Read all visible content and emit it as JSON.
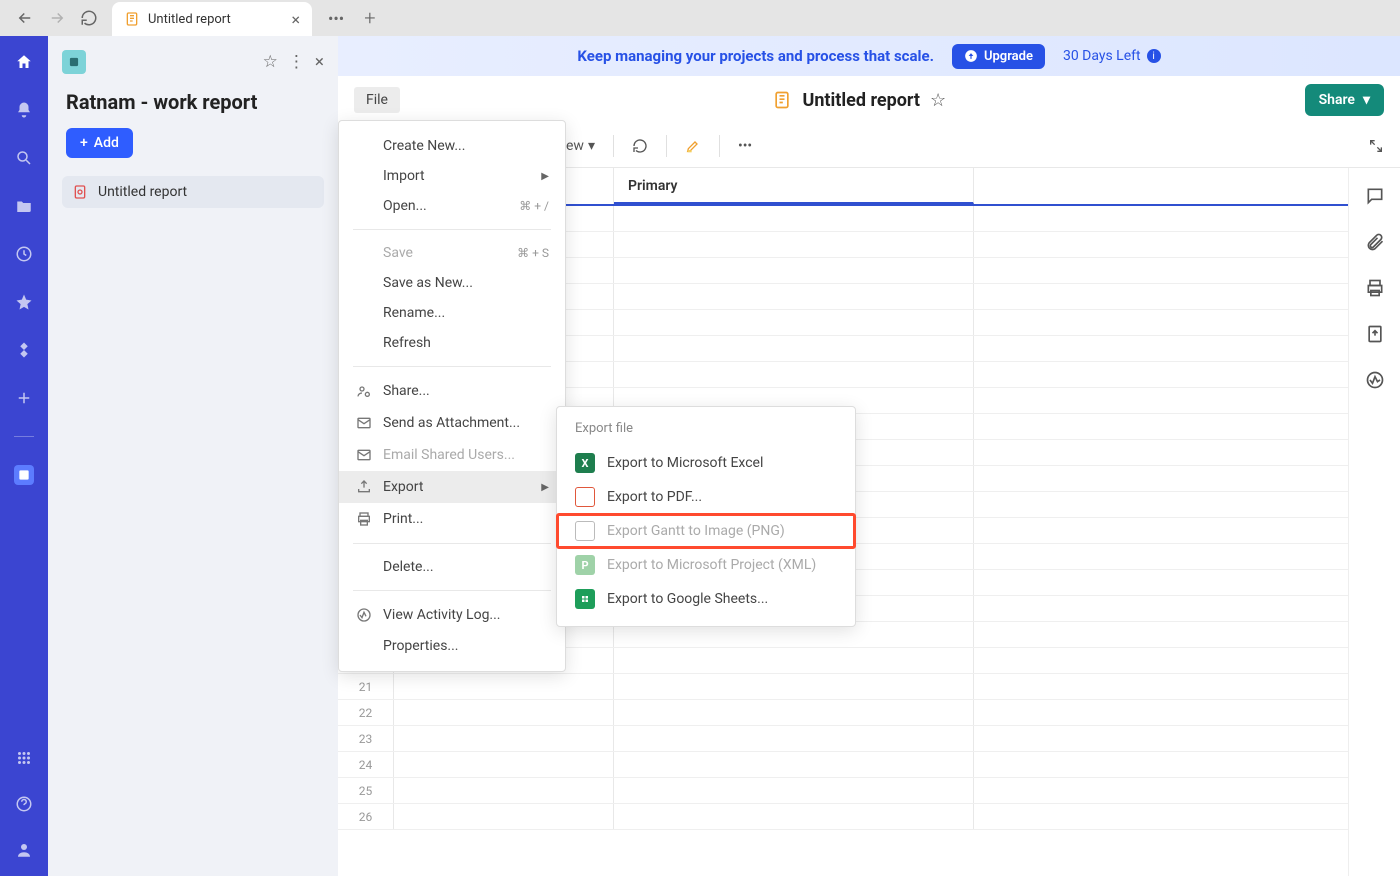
{
  "tab": {
    "title": "Untitled report"
  },
  "leftPanel": {
    "title": "Ratnam - work report",
    "add_button": "Add",
    "item_label": "Untitled report"
  },
  "banner": {
    "text": "Keep managing your projects and process that scale.",
    "upgrade": "Upgrade",
    "days_left": "30 Days Left"
  },
  "doc": {
    "title": "Untitled report",
    "share": "Share",
    "file_button": "File"
  },
  "toolbar": {
    "view_suffix": "ew"
  },
  "grid": {
    "primary_header": "Primary",
    "visible_rows": [
      "21",
      "22",
      "23",
      "24",
      "25",
      "26"
    ]
  },
  "fileMenu": {
    "create_new": "Create New...",
    "import": "Import",
    "open": "Open...",
    "open_kbd": "⌘ + /",
    "save": "Save",
    "save_kbd": "⌘ + S",
    "save_as_new": "Save as New...",
    "rename": "Rename...",
    "refresh": "Refresh",
    "share": "Share...",
    "send_attachment": "Send as Attachment...",
    "email_shared": "Email Shared Users...",
    "export": "Export",
    "print": "Print...",
    "delete": "Delete...",
    "activity_log": "View Activity Log...",
    "properties": "Properties..."
  },
  "exportMenu": {
    "title": "Export file",
    "excel": "Export to Microsoft Excel",
    "pdf": "Export to PDF...",
    "gantt": "Export Gantt to Image (PNG)",
    "msproject": "Export to Microsoft Project (XML)",
    "gsheets": "Export to Google Sheets..."
  }
}
